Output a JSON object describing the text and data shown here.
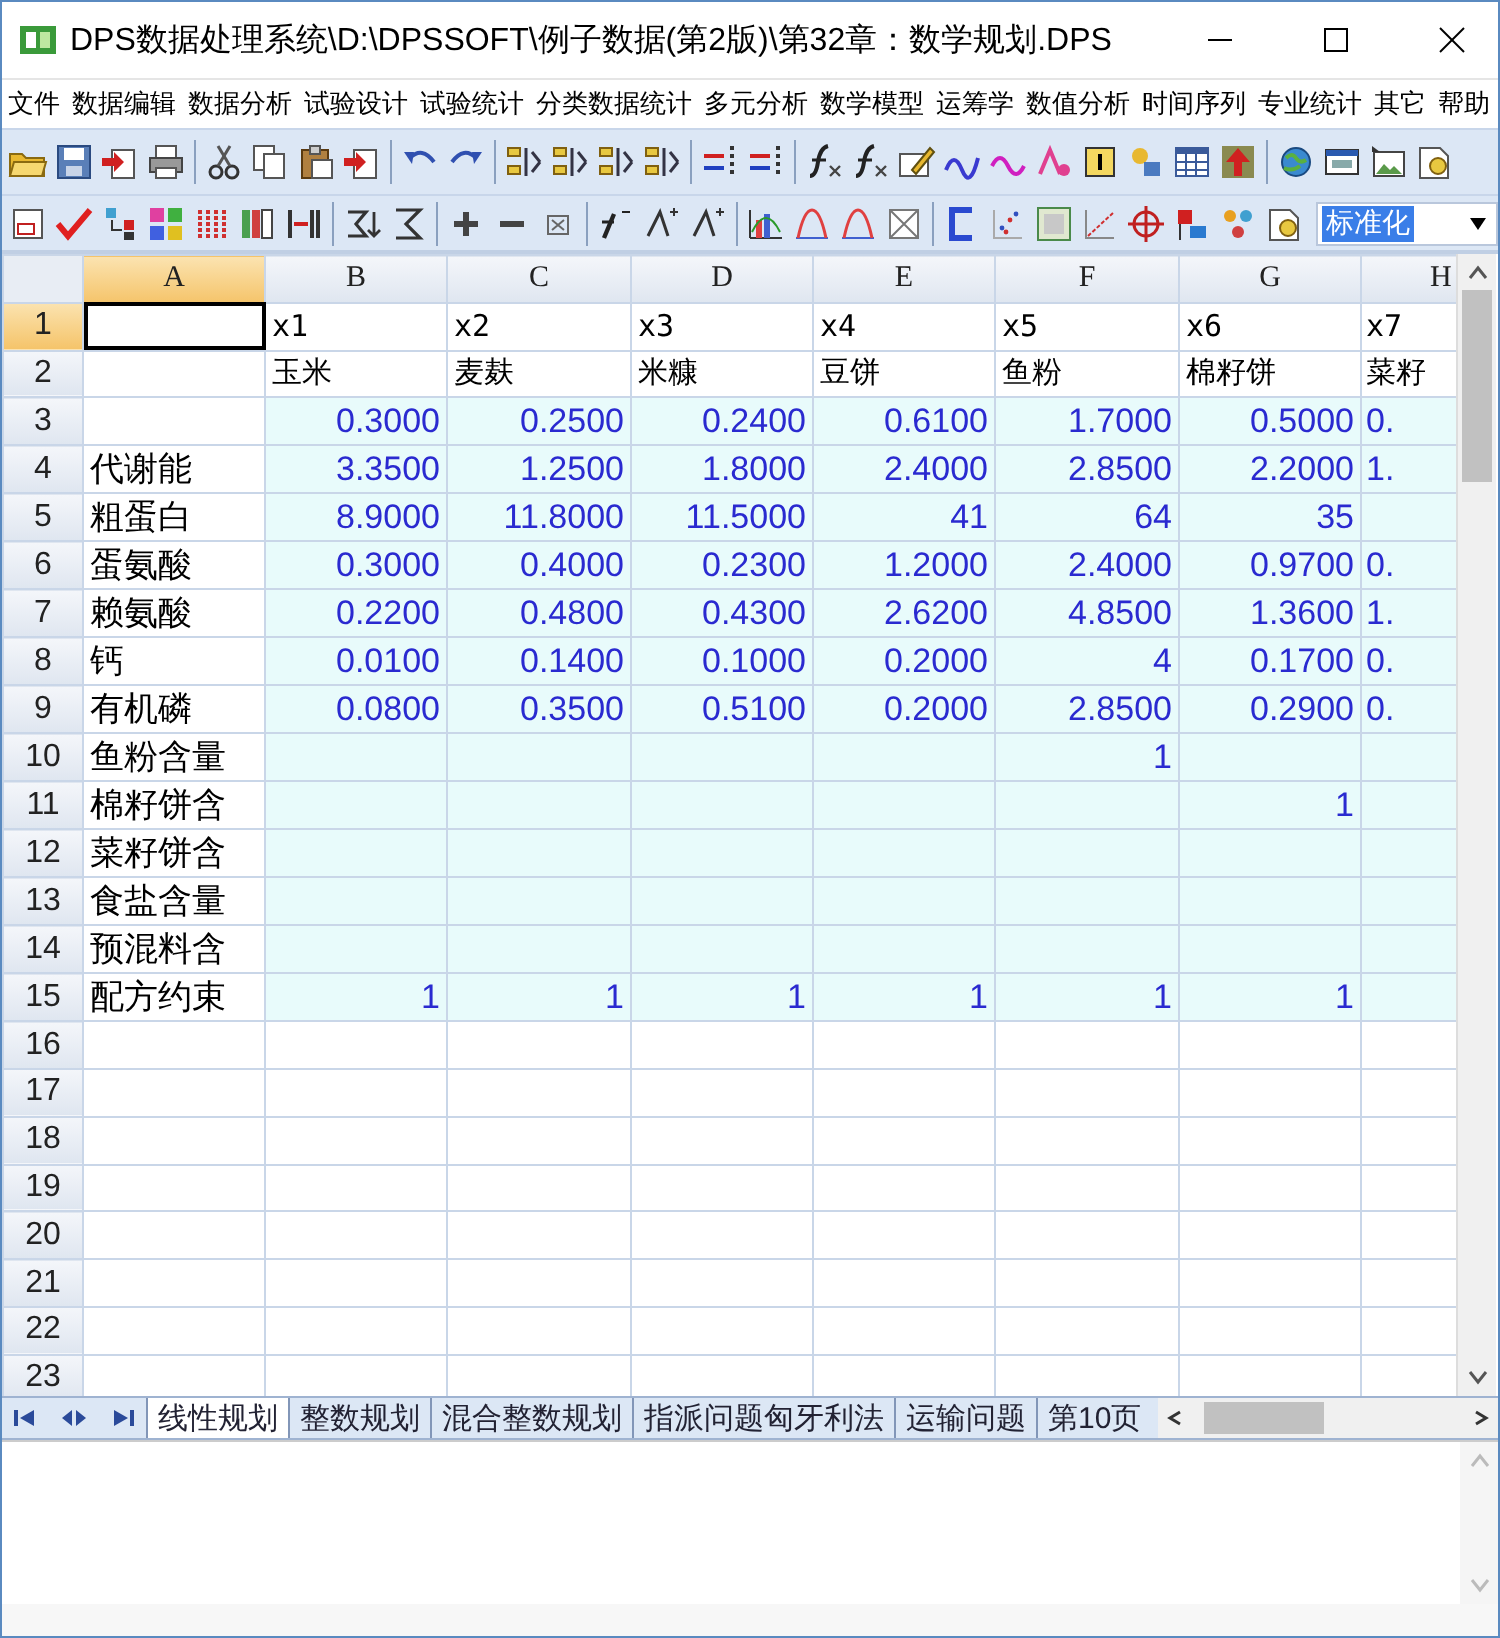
{
  "window": {
    "title": "DPS数据处理系统\\D:\\DPSSOFT\\例子数据(第2版)\\第32章：数学规划.DPS"
  },
  "menu": [
    "文件",
    "数据编辑",
    "数据分析",
    "试验设计",
    "试验统计",
    "分类数据统计",
    "多元分析",
    "数学模型",
    "运筹学",
    "数值分析",
    "时间序列",
    "专业统计",
    "其它",
    "帮助"
  ],
  "toolbar_combo": {
    "value": "标准化"
  },
  "sheet": {
    "columns": [
      {
        "label": "A",
        "selected": true
      },
      {
        "label": "B",
        "selected": false
      },
      {
        "label": "C",
        "selected": false
      },
      {
        "label": "D",
        "selected": false
      },
      {
        "label": "E",
        "selected": false
      },
      {
        "label": "F",
        "selected": false
      },
      {
        "label": "G",
        "selected": false
      },
      {
        "label": "H",
        "selected": false
      }
    ],
    "rows": [
      {
        "label": "1",
        "selected": true,
        "kind": "text",
        "cells": [
          null,
          "x1",
          "x2",
          "x3",
          "x4",
          "x5",
          "x6",
          "x7"
        ]
      },
      {
        "label": "2",
        "selected": false,
        "kind": "text",
        "cells": [
          null,
          "玉米",
          "麦麸",
          "米糠",
          "豆饼",
          "鱼粉",
          "棉籽饼",
          "菜籽"
        ]
      },
      {
        "label": "3",
        "selected": false,
        "kind": "data",
        "cells": [
          null,
          "0.3000",
          "0.2500",
          "0.2400",
          "0.6100",
          "1.7000",
          "0.5000",
          "0."
        ]
      },
      {
        "label": "4",
        "selected": false,
        "kind": "data",
        "cells": [
          "代谢能",
          "3.3500",
          "1.2500",
          "1.8000",
          "2.4000",
          "2.8500",
          "2.2000",
          "1."
        ]
      },
      {
        "label": "5",
        "selected": false,
        "kind": "data",
        "cells": [
          "粗蛋白",
          "8.9000",
          "11.8000",
          "11.5000",
          "41",
          "64",
          "35",
          null
        ]
      },
      {
        "label": "6",
        "selected": false,
        "kind": "data",
        "cells": [
          "蛋氨酸",
          "0.3000",
          "0.4000",
          "0.2300",
          "1.2000",
          "2.4000",
          "0.9700",
          "0."
        ]
      },
      {
        "label": "7",
        "selected": false,
        "kind": "data",
        "cells": [
          "赖氨酸",
          "0.2200",
          "0.4800",
          "0.4300",
          "2.6200",
          "4.8500",
          "1.3600",
          "1."
        ]
      },
      {
        "label": "8",
        "selected": false,
        "kind": "data",
        "cells": [
          "钙",
          "0.0100",
          "0.1400",
          "0.1000",
          "0.2000",
          "4",
          "0.1700",
          "0."
        ]
      },
      {
        "label": "9",
        "selected": false,
        "kind": "data",
        "cells": [
          "有机磷",
          "0.0800",
          "0.3500",
          "0.5100",
          "0.2000",
          "2.8500",
          "0.2900",
          "0."
        ]
      },
      {
        "label": "10",
        "selected": false,
        "kind": "data",
        "cells": [
          "鱼粉含量",
          null,
          null,
          null,
          null,
          "1",
          null,
          null
        ]
      },
      {
        "label": "11",
        "selected": false,
        "kind": "data",
        "cells": [
          "棉籽饼含",
          null,
          null,
          null,
          null,
          null,
          "1",
          null
        ]
      },
      {
        "label": "12",
        "selected": false,
        "kind": "data",
        "cells": [
          "菜籽饼含",
          null,
          null,
          null,
          null,
          null,
          null,
          null
        ]
      },
      {
        "label": "13",
        "selected": false,
        "kind": "data",
        "cells": [
          "食盐含量",
          null,
          null,
          null,
          null,
          null,
          null,
          null
        ]
      },
      {
        "label": "14",
        "selected": false,
        "kind": "data",
        "cells": [
          "预混料含",
          null,
          null,
          null,
          null,
          null,
          null,
          null
        ]
      },
      {
        "label": "15",
        "selected": false,
        "kind": "data",
        "cells": [
          "配方约束",
          "1",
          "1",
          "1",
          "1",
          "1",
          "1",
          null
        ]
      },
      {
        "label": "16",
        "selected": false,
        "kind": "blank"
      },
      {
        "label": "17",
        "selected": false,
        "kind": "blank"
      },
      {
        "label": "18",
        "selected": false,
        "kind": "blank"
      },
      {
        "label": "19",
        "selected": false,
        "kind": "blank"
      },
      {
        "label": "20",
        "selected": false,
        "kind": "blank"
      },
      {
        "label": "21",
        "selected": false,
        "kind": "blank"
      },
      {
        "label": "22",
        "selected": false,
        "kind": "blank"
      },
      {
        "label": "23",
        "selected": false,
        "kind": "blank"
      }
    ]
  },
  "sheet_tabs": [
    {
      "label": "线性规划",
      "selected": true
    },
    {
      "label": "整数规划",
      "selected": false
    },
    {
      "label": "混合整数规划",
      "selected": false
    },
    {
      "label": "指派问题匈牙利法",
      "selected": false
    },
    {
      "label": "运输问题",
      "selected": false
    },
    {
      "label": "第10页",
      "selected": false
    }
  ]
}
